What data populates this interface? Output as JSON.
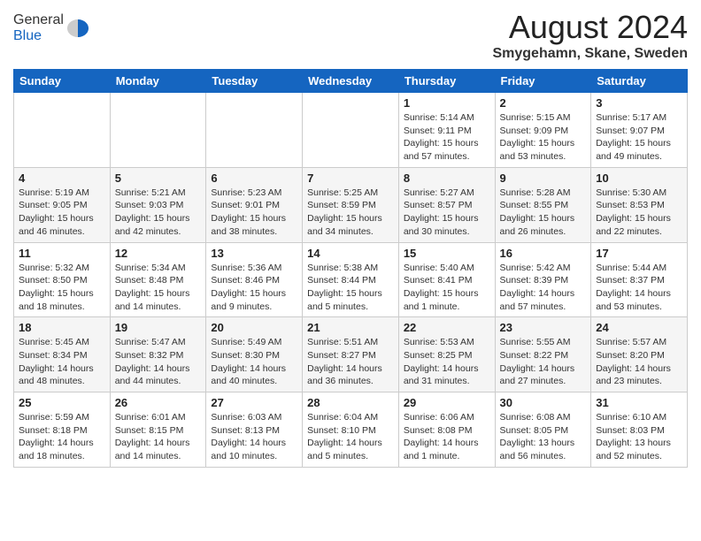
{
  "header": {
    "logo_general": "General",
    "logo_blue": "Blue",
    "month_year": "August 2024",
    "location": "Smygehamn, Skane, Sweden"
  },
  "calendar": {
    "days_of_week": [
      "Sunday",
      "Monday",
      "Tuesday",
      "Wednesday",
      "Thursday",
      "Friday",
      "Saturday"
    ],
    "weeks": [
      [
        {
          "day": "",
          "detail": ""
        },
        {
          "day": "",
          "detail": ""
        },
        {
          "day": "",
          "detail": ""
        },
        {
          "day": "",
          "detail": ""
        },
        {
          "day": "1",
          "detail": "Sunrise: 5:14 AM\nSunset: 9:11 PM\nDaylight: 15 hours\nand 57 minutes."
        },
        {
          "day": "2",
          "detail": "Sunrise: 5:15 AM\nSunset: 9:09 PM\nDaylight: 15 hours\nand 53 minutes."
        },
        {
          "day": "3",
          "detail": "Sunrise: 5:17 AM\nSunset: 9:07 PM\nDaylight: 15 hours\nand 49 minutes."
        }
      ],
      [
        {
          "day": "4",
          "detail": "Sunrise: 5:19 AM\nSunset: 9:05 PM\nDaylight: 15 hours\nand 46 minutes."
        },
        {
          "day": "5",
          "detail": "Sunrise: 5:21 AM\nSunset: 9:03 PM\nDaylight: 15 hours\nand 42 minutes."
        },
        {
          "day": "6",
          "detail": "Sunrise: 5:23 AM\nSunset: 9:01 PM\nDaylight: 15 hours\nand 38 minutes."
        },
        {
          "day": "7",
          "detail": "Sunrise: 5:25 AM\nSunset: 8:59 PM\nDaylight: 15 hours\nand 34 minutes."
        },
        {
          "day": "8",
          "detail": "Sunrise: 5:27 AM\nSunset: 8:57 PM\nDaylight: 15 hours\nand 30 minutes."
        },
        {
          "day": "9",
          "detail": "Sunrise: 5:28 AM\nSunset: 8:55 PM\nDaylight: 15 hours\nand 26 minutes."
        },
        {
          "day": "10",
          "detail": "Sunrise: 5:30 AM\nSunset: 8:53 PM\nDaylight: 15 hours\nand 22 minutes."
        }
      ],
      [
        {
          "day": "11",
          "detail": "Sunrise: 5:32 AM\nSunset: 8:50 PM\nDaylight: 15 hours\nand 18 minutes."
        },
        {
          "day": "12",
          "detail": "Sunrise: 5:34 AM\nSunset: 8:48 PM\nDaylight: 15 hours\nand 14 minutes."
        },
        {
          "day": "13",
          "detail": "Sunrise: 5:36 AM\nSunset: 8:46 PM\nDaylight: 15 hours\nand 9 minutes."
        },
        {
          "day": "14",
          "detail": "Sunrise: 5:38 AM\nSunset: 8:44 PM\nDaylight: 15 hours\nand 5 minutes."
        },
        {
          "day": "15",
          "detail": "Sunrise: 5:40 AM\nSunset: 8:41 PM\nDaylight: 15 hours\nand 1 minute."
        },
        {
          "day": "16",
          "detail": "Sunrise: 5:42 AM\nSunset: 8:39 PM\nDaylight: 14 hours\nand 57 minutes."
        },
        {
          "day": "17",
          "detail": "Sunrise: 5:44 AM\nSunset: 8:37 PM\nDaylight: 14 hours\nand 53 minutes."
        }
      ],
      [
        {
          "day": "18",
          "detail": "Sunrise: 5:45 AM\nSunset: 8:34 PM\nDaylight: 14 hours\nand 48 minutes."
        },
        {
          "day": "19",
          "detail": "Sunrise: 5:47 AM\nSunset: 8:32 PM\nDaylight: 14 hours\nand 44 minutes."
        },
        {
          "day": "20",
          "detail": "Sunrise: 5:49 AM\nSunset: 8:30 PM\nDaylight: 14 hours\nand 40 minutes."
        },
        {
          "day": "21",
          "detail": "Sunrise: 5:51 AM\nSunset: 8:27 PM\nDaylight: 14 hours\nand 36 minutes."
        },
        {
          "day": "22",
          "detail": "Sunrise: 5:53 AM\nSunset: 8:25 PM\nDaylight: 14 hours\nand 31 minutes."
        },
        {
          "day": "23",
          "detail": "Sunrise: 5:55 AM\nSunset: 8:22 PM\nDaylight: 14 hours\nand 27 minutes."
        },
        {
          "day": "24",
          "detail": "Sunrise: 5:57 AM\nSunset: 8:20 PM\nDaylight: 14 hours\nand 23 minutes."
        }
      ],
      [
        {
          "day": "25",
          "detail": "Sunrise: 5:59 AM\nSunset: 8:18 PM\nDaylight: 14 hours\nand 18 minutes."
        },
        {
          "day": "26",
          "detail": "Sunrise: 6:01 AM\nSunset: 8:15 PM\nDaylight: 14 hours\nand 14 minutes."
        },
        {
          "day": "27",
          "detail": "Sunrise: 6:03 AM\nSunset: 8:13 PM\nDaylight: 14 hours\nand 10 minutes."
        },
        {
          "day": "28",
          "detail": "Sunrise: 6:04 AM\nSunset: 8:10 PM\nDaylight: 14 hours\nand 5 minutes."
        },
        {
          "day": "29",
          "detail": "Sunrise: 6:06 AM\nSunset: 8:08 PM\nDaylight: 14 hours\nand 1 minute."
        },
        {
          "day": "30",
          "detail": "Sunrise: 6:08 AM\nSunset: 8:05 PM\nDaylight: 13 hours\nand 56 minutes."
        },
        {
          "day": "31",
          "detail": "Sunrise: 6:10 AM\nSunset: 8:03 PM\nDaylight: 13 hours\nand 52 minutes."
        }
      ]
    ]
  }
}
